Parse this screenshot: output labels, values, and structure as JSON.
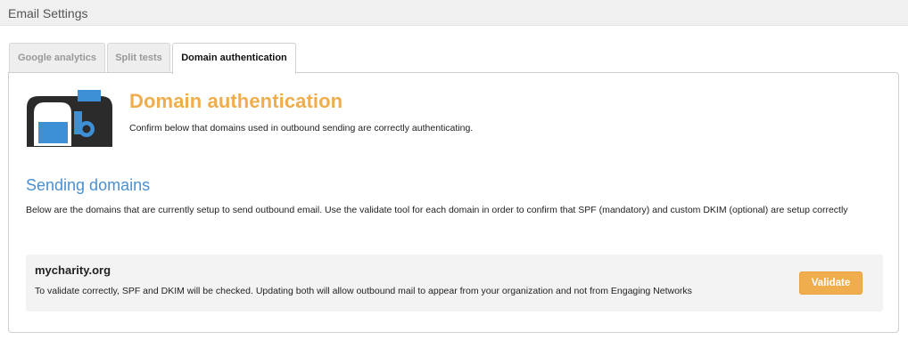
{
  "header": {
    "title": "Email Settings"
  },
  "tabs": [
    {
      "label": "Google analytics",
      "active": false
    },
    {
      "label": "Split tests",
      "active": false
    },
    {
      "label": "Domain authentication",
      "active": true
    }
  ],
  "panel": {
    "icon": "mailbox-icon",
    "heading": "Domain authentication",
    "subheading": "Confirm below that domains used in outbound sending are correctly authenticating.",
    "section_title": "Sending domains",
    "section_desc": "Below are the domains that are currently setup to send outbound email. Use the validate tool for each domain in order to confirm that SPF (mandatory) and custom DKIM (optional) are setup correctly",
    "domains": [
      {
        "name": "mycharity.org",
        "note": "To validate correctly, SPF and DKIM will be checked. Updating both will allow outbound mail to appear from your organization and not from Engaging Networks",
        "button_label": "Validate"
      }
    ]
  },
  "colors": {
    "accent": "#f0ad4e",
    "link_blue": "#4a90d0",
    "logo_dark": "#2b2b2b",
    "logo_blue": "#3d8fd6"
  }
}
